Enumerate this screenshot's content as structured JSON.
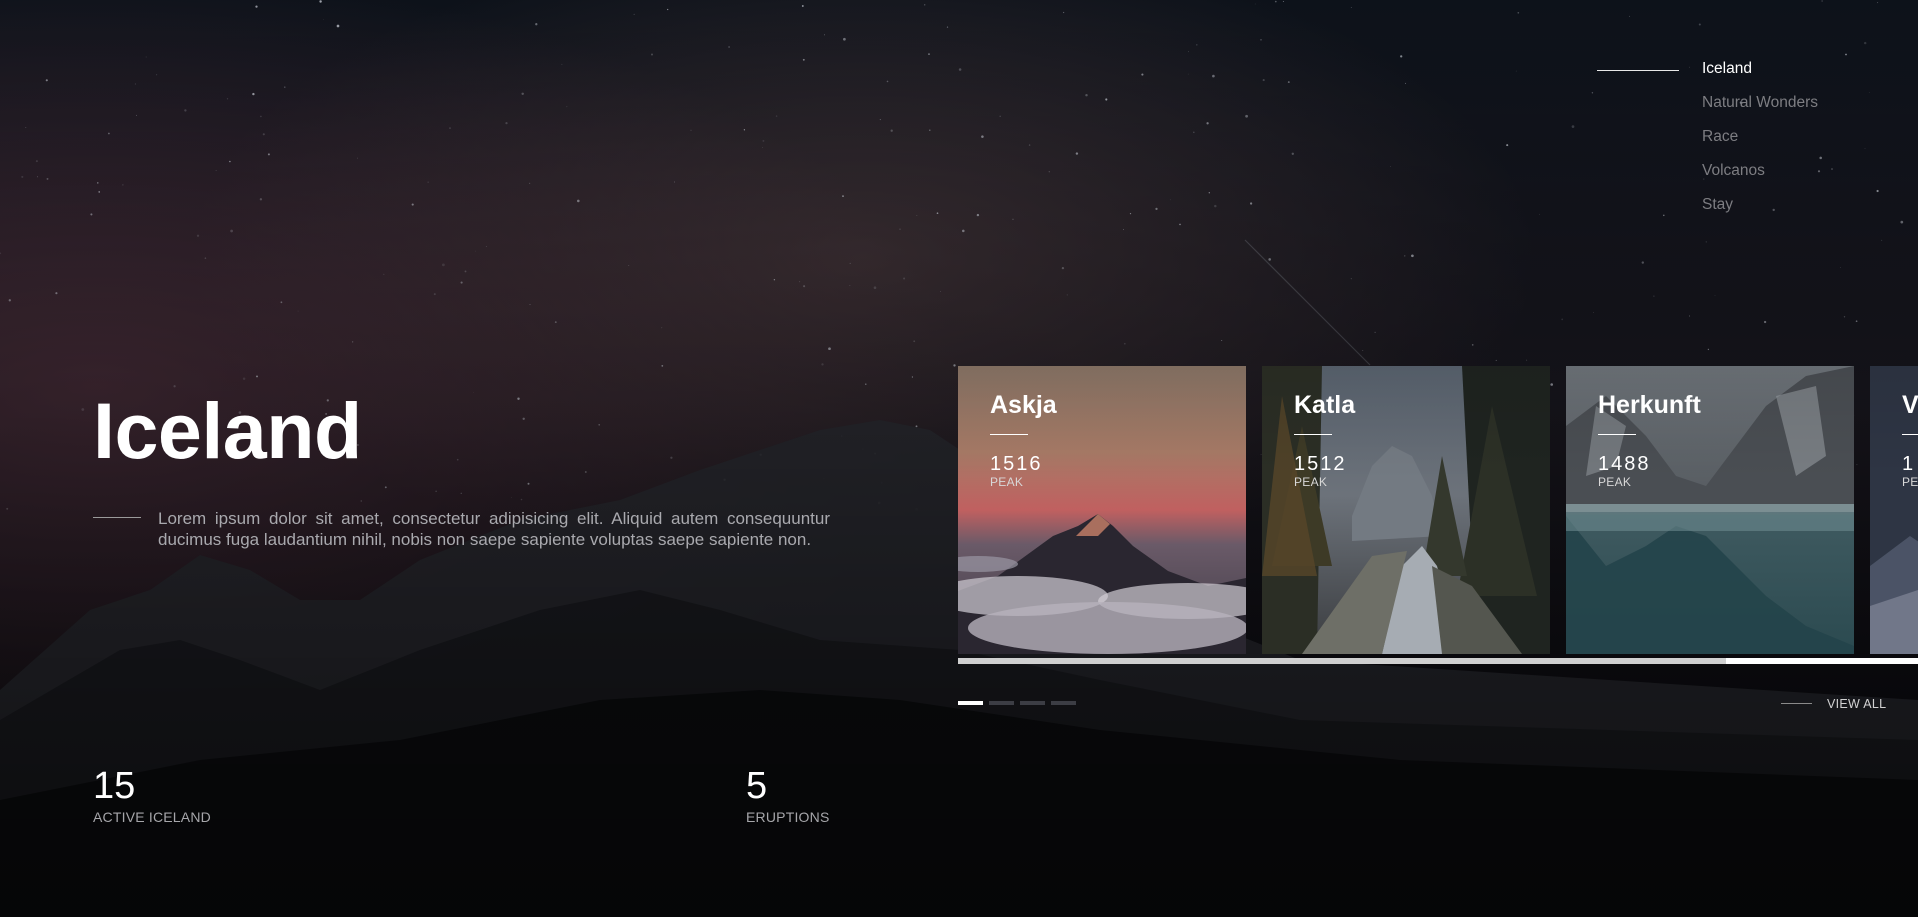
{
  "nav": {
    "items": [
      {
        "label": "Iceland",
        "active": true
      },
      {
        "label": "Natural Wonders",
        "active": false
      },
      {
        "label": "Race",
        "active": false
      },
      {
        "label": "Volcanos",
        "active": false
      },
      {
        "label": "Stay",
        "active": false
      }
    ]
  },
  "hero": {
    "title": "Iceland",
    "description": "Lorem ipsum dolor sit amet, consectetur adipisicing elit. Aliquid autem consequuntur ducimus fuga laudantium nihil, nobis non saepe sapiente voluptas saepe sapiente non."
  },
  "stats": [
    {
      "value": "15",
      "label": "ACTIVE ICELAND"
    },
    {
      "value": "5",
      "label": "ERUPTIONS"
    }
  ],
  "cards": [
    {
      "name": "Askja",
      "peak": "1516",
      "peak_label": "PEAK",
      "image": "mountain-sunset-clouds"
    },
    {
      "name": "Katla",
      "peak": "1512",
      "peak_label": "PEAK",
      "image": "forest-river"
    },
    {
      "name": "Herkunft",
      "peak": "1488",
      "peak_label": "PEAK",
      "image": "mountain-lake"
    },
    {
      "name": "V",
      "peak": "1",
      "peak_label": "PE",
      "image": "partial-card"
    }
  ],
  "slider": {
    "active_dot": 0,
    "dot_count": 4,
    "scroll_position": 0.8
  },
  "view_all": {
    "label": "VIEW ALL"
  },
  "colors": {
    "background": "#0a0c12",
    "text_primary": "#ffffff",
    "text_muted": "#7d7d82"
  }
}
